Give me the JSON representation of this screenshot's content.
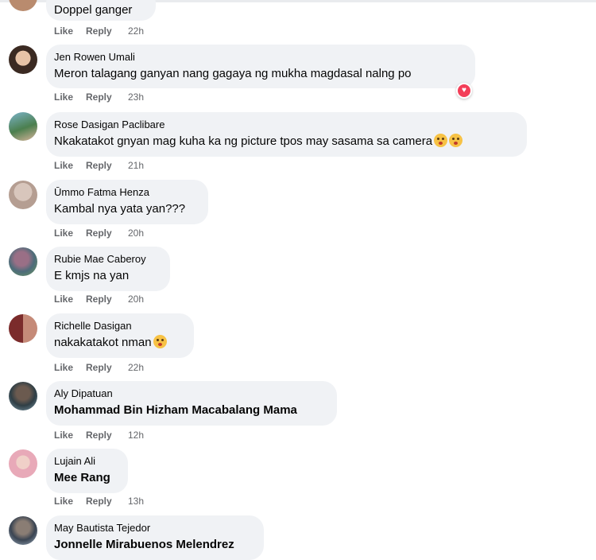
{
  "actions": {
    "like": "Like",
    "reply": "Reply"
  },
  "comments": [
    {
      "author": "",
      "text": "Doppel ganger",
      "time": "22h"
    },
    {
      "author": "Jen Rowen Umali",
      "text": "Meron talagang ganyan nang gagaya ng mukha magdasal nalng po",
      "time": "23h",
      "reaction": "heart-icon"
    },
    {
      "author": "Rose Dasigan Paclibare",
      "text": "Nkakatakot gnyan mag kuha ka ng picture tpos may sasama sa camera",
      "time": "21h"
    },
    {
      "author": "Ūmmo Fatma Henza",
      "text": "Kambal nya yata yan???",
      "time": "20h"
    },
    {
      "author": "Rubie Mae Caberoy",
      "text": "E kmjs na yan",
      "time": "20h"
    },
    {
      "author": "Richelle Dasigan",
      "text": "nakakatakot nman",
      "time": "22h"
    },
    {
      "author": "Aly Dipatuan",
      "text": "Mohammad Bin Hizham Macabalang Mama",
      "time": "12h"
    },
    {
      "author": "Lujain Ali",
      "text": "Mee Rang",
      "time": "13h"
    },
    {
      "author": "May Bautista Tejedor",
      "text": "Jonnelle Mirabuenos Melendrez",
      "time": ""
    }
  ],
  "colors": {
    "bubble": "#f0f2f5",
    "meta": "#65676b",
    "heart": "#f33e58"
  }
}
